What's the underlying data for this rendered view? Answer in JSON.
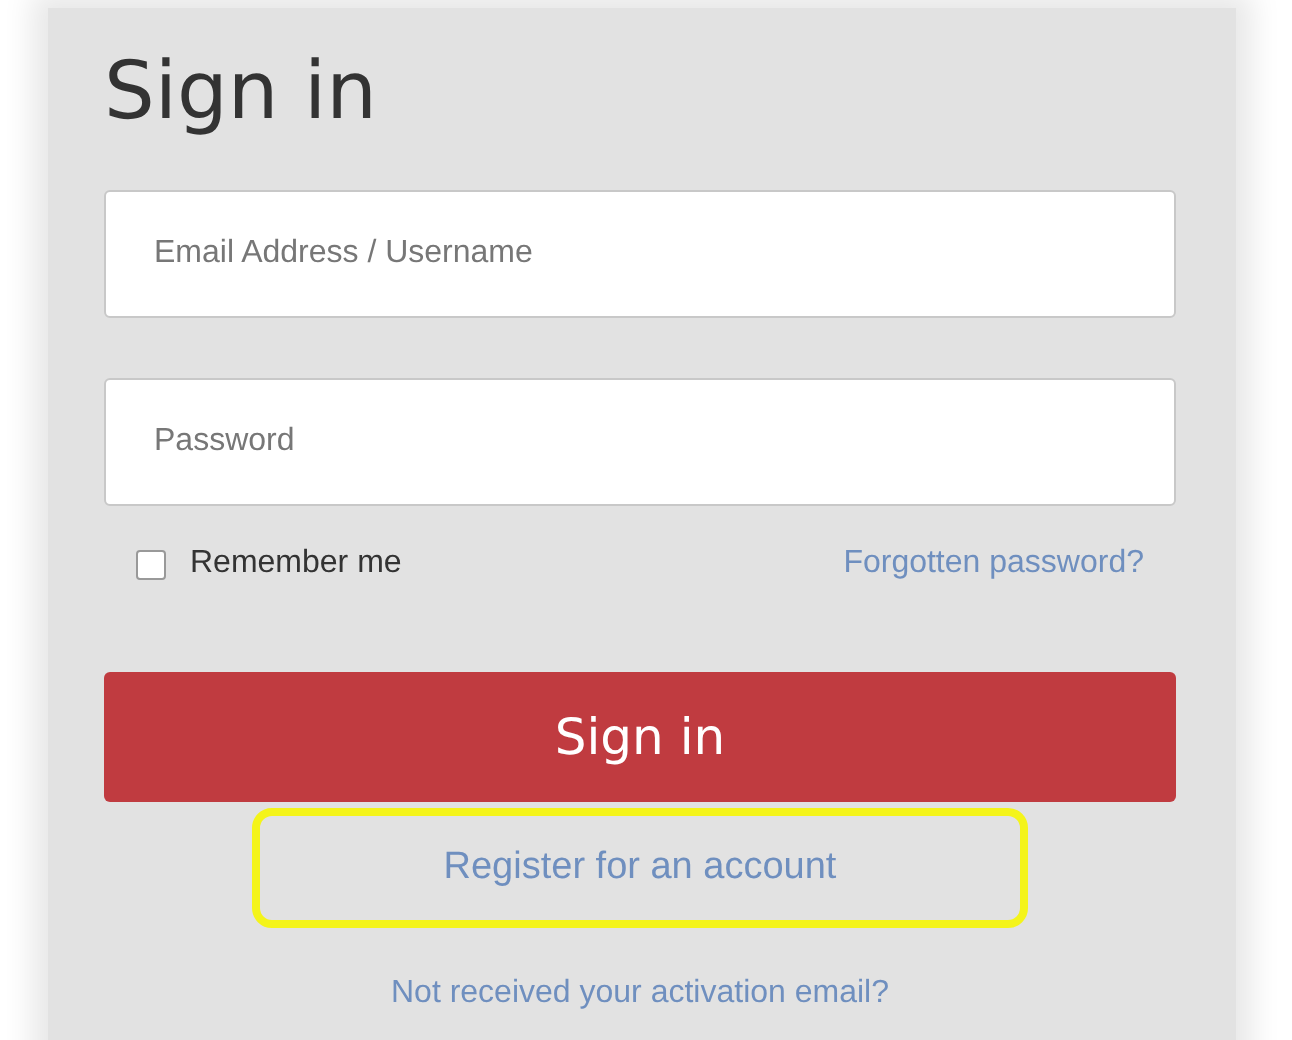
{
  "title": "Sign in",
  "username_field": {
    "placeholder": "Email Address / Username"
  },
  "password_field": {
    "placeholder": "Password"
  },
  "remember": {
    "label": "Remember me",
    "checked": false
  },
  "forgot_link": "Forgotten password?",
  "submit_button": "Sign in",
  "register_link": {
    "label": "Register for an account",
    "highlighted": true
  },
  "activation_link": "Not received your activation email?"
}
